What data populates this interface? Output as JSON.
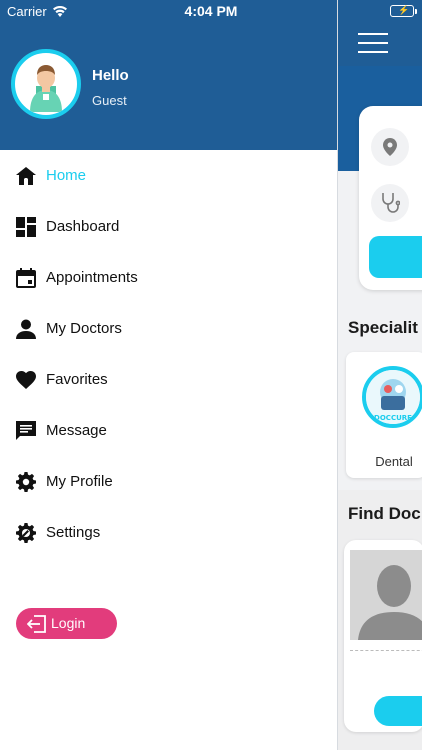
{
  "status_bar": {
    "carrier": "Carrier",
    "time": "4:04 PM"
  },
  "colors": {
    "header_blue": "#1f5d96",
    "accent_cyan": "#1bcdee",
    "login_pink": "#e23c7c"
  },
  "drawer": {
    "greeting": "Hello",
    "user_name": "Guest",
    "menu": [
      {
        "label": "Home",
        "icon": "home-icon",
        "active": true
      },
      {
        "label": "Dashboard",
        "icon": "dashboard-icon",
        "active": false
      },
      {
        "label": "Appointments",
        "icon": "calendar-icon",
        "active": false
      },
      {
        "label": "My Doctors",
        "icon": "person-icon",
        "active": false
      },
      {
        "label": "Favorites",
        "icon": "heart-icon",
        "active": false
      },
      {
        "label": "Message",
        "icon": "message-icon",
        "active": false
      },
      {
        "label": "My Profile",
        "icon": "gear-icon",
        "active": false
      },
      {
        "label": "Settings",
        "icon": "settings-gear-icon",
        "active": false
      }
    ],
    "login_label": "Login"
  },
  "background_screen": {
    "section_specialities": "Specialit",
    "speciality_label": "Dental",
    "speciality_logo_text": "DOCCURE",
    "section_find_doctors": "Find Doc"
  }
}
